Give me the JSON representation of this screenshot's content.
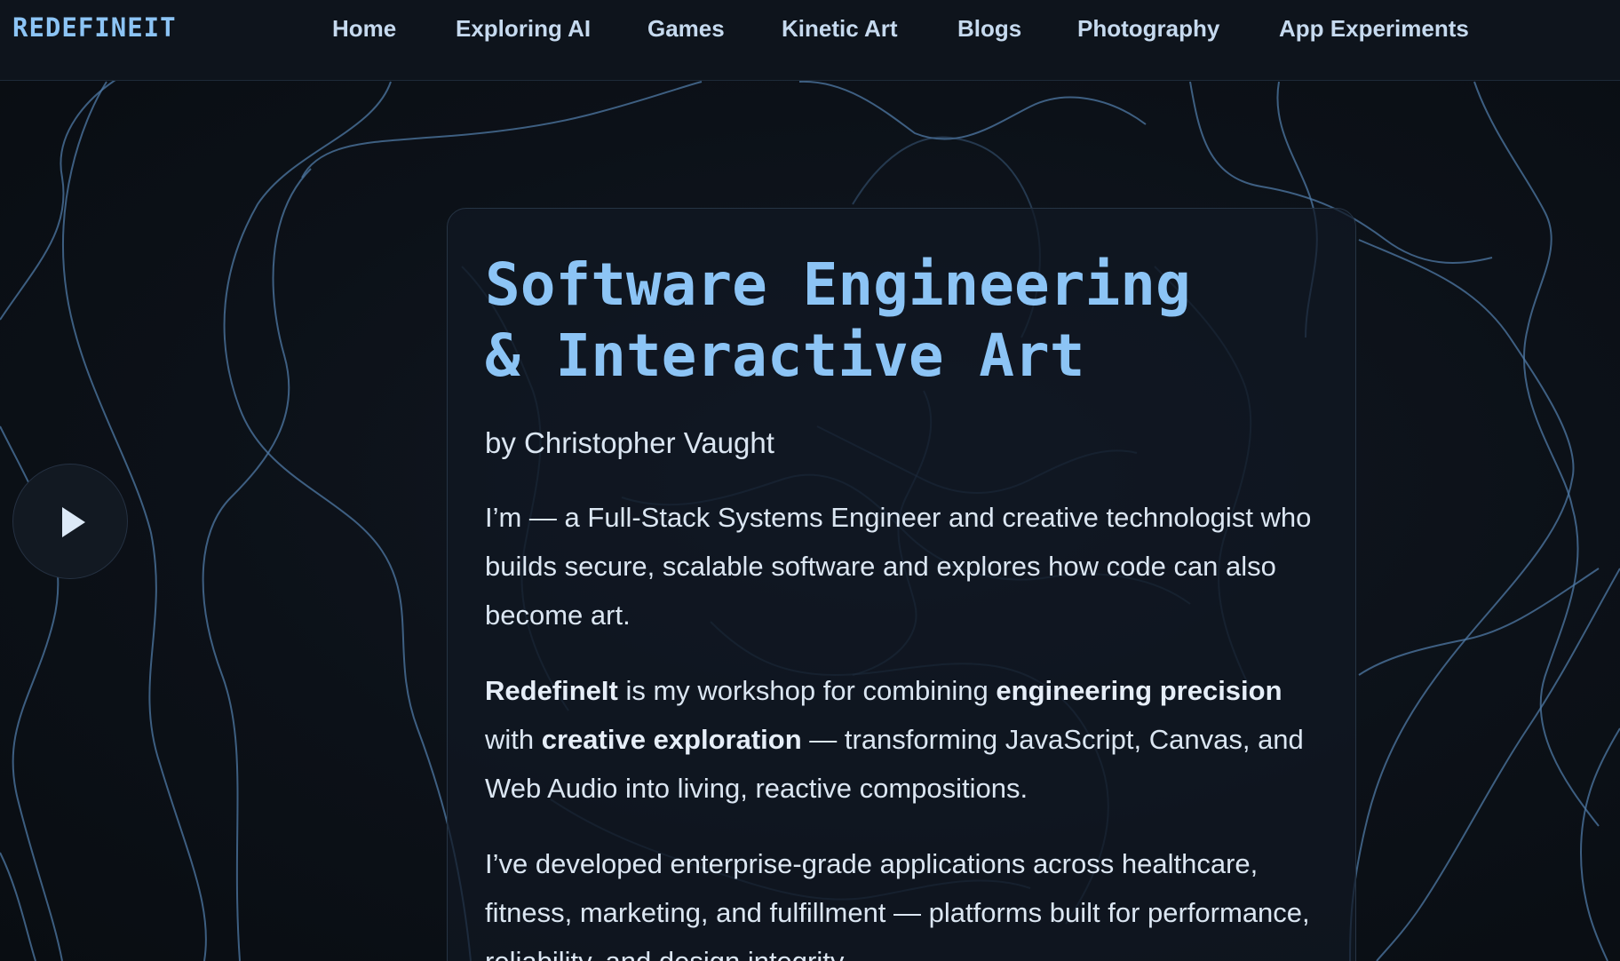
{
  "brand": "REDEFINEIT",
  "nav": {
    "items": [
      {
        "label": "Home"
      },
      {
        "label": "Exploring AI"
      },
      {
        "label": "Games"
      },
      {
        "label": "Kinetic Art"
      },
      {
        "label": "Blogs"
      },
      {
        "label": "Photography"
      },
      {
        "label": "App Experiments"
      }
    ]
  },
  "hero": {
    "title_line1": "Software Engineering",
    "title_line2": "& Interactive Art",
    "byline": "by Christopher Vaught",
    "intro": "I’m — a Full-Stack Systems Engineer and creative technologist who builds secure, scalable software and explores how code can also become art.",
    "workshop": {
      "brand": "RedefineIt",
      "t1": " is my workshop for combining ",
      "b1": "engineering precision",
      "t2": " with ",
      "b2": "creative exploration",
      "t3": " — transforming JavaScript, Canvas, and Web Audio into living, reactive compositions."
    },
    "experience": "I’ve developed enterprise-grade applications across healthcare, fitness, marketing, and fulfillment — platforms built for performance, reliability, and design integrity."
  },
  "play_button": {
    "icon": "play-icon"
  },
  "colors": {
    "accent": "#8cc4f5",
    "background": "#0b0f15",
    "line": "#4f79a6",
    "text": "#dbe6f2"
  }
}
